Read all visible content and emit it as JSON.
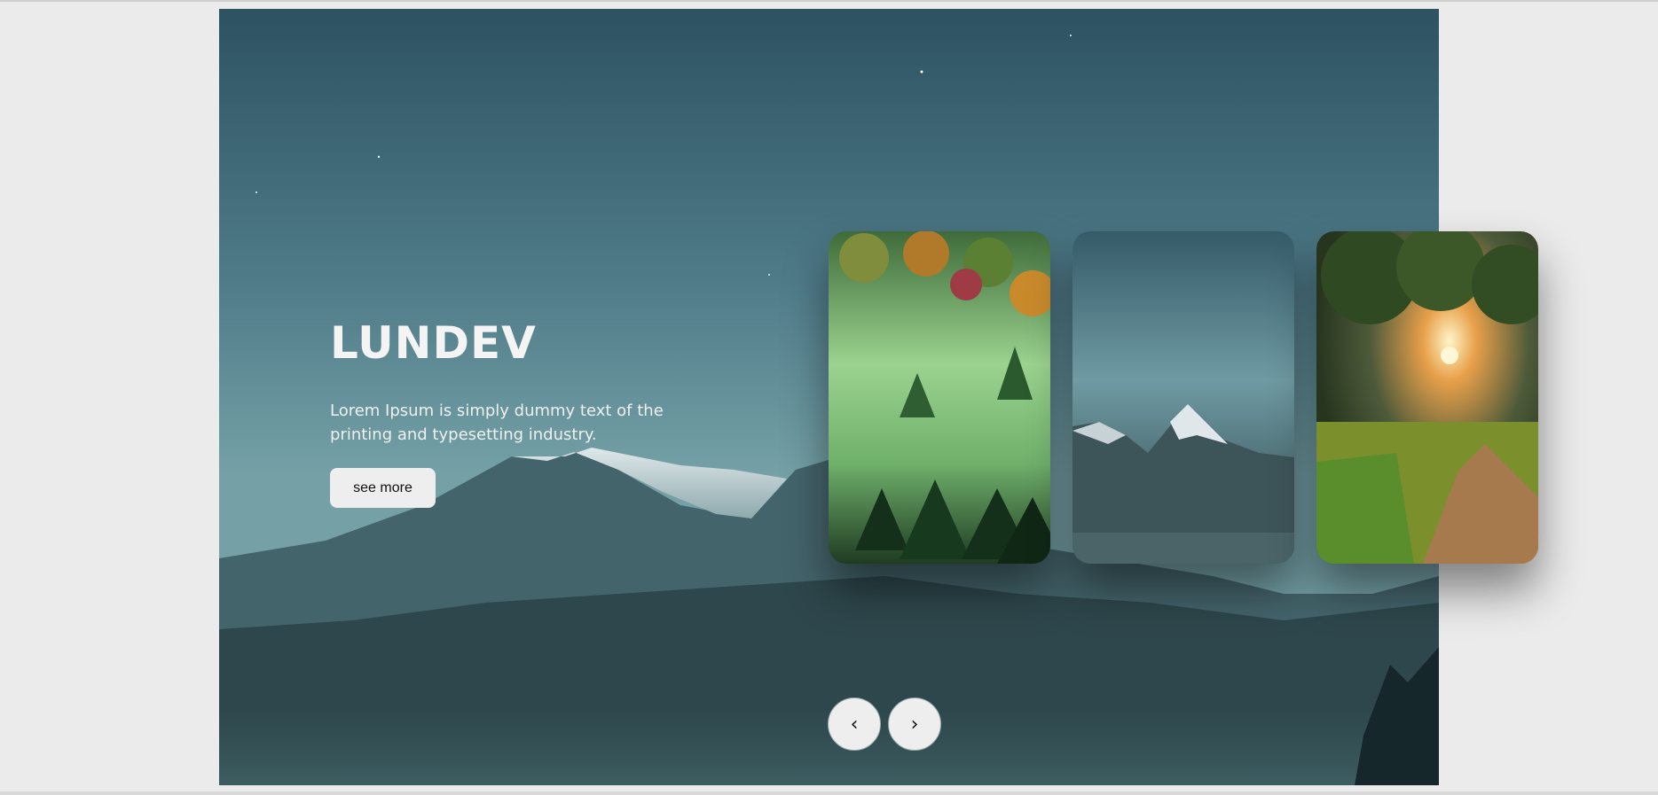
{
  "hero": {
    "title": "LUNDEV",
    "description": "Lorem Ipsum is simply dummy text of the printing and typesetting industry.",
    "see_more_label": "see more"
  },
  "thumbnails": [
    {
      "scene": "misty-forest",
      "icon": "forest-image"
    },
    {
      "scene": "snowy-mountain",
      "icon": "mountain-image"
    },
    {
      "scene": "sunset-country-road",
      "icon": "road-image"
    }
  ],
  "navigation": {
    "prev_icon": "chevron-left-icon",
    "next_icon": "chevron-right-icon",
    "prev_glyph": "‹",
    "next_glyph": "›"
  },
  "colors": {
    "page_background": "#ebebeb",
    "button_background": "#eeeeee",
    "text_light": "#f4f4f4"
  }
}
